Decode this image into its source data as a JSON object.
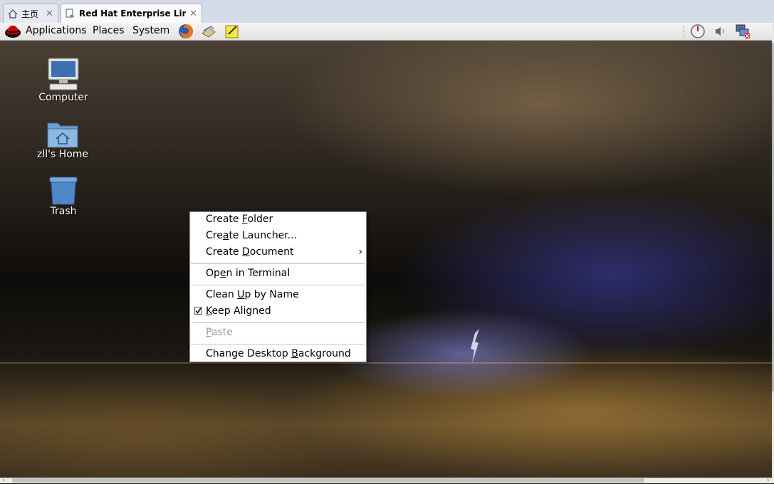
{
  "browser": {
    "tabs": [
      {
        "label": "主页",
        "icon": "home-icon"
      },
      {
        "label": "Red Hat Enterprise Linux ...",
        "icon": "vm-icon"
      }
    ]
  },
  "panel": {
    "menus": [
      "Applications",
      "Places",
      "System"
    ],
    "launchers": [
      "firefox-icon",
      "mail-icon",
      "notes-icon"
    ],
    "tray": [
      "clock-icon",
      "volume-icon",
      "network-icon"
    ]
  },
  "desktop": {
    "icons": [
      {
        "label": "Computer",
        "icon": "computer-icon"
      },
      {
        "label": "zll's Home",
        "icon": "home-folder-icon"
      },
      {
        "label": "Trash",
        "icon": "trash-icon"
      }
    ]
  },
  "context_menu": {
    "items": [
      {
        "label": "Create Folder",
        "mnemonic": "F"
      },
      {
        "label": "Create Launcher...",
        "mnemonic": "a"
      },
      {
        "label": "Create Document",
        "mnemonic": "D",
        "submenu": true
      },
      {
        "label": "Open in Terminal",
        "mnemonic": "e"
      },
      {
        "label": "Clean Up by Name",
        "mnemonic": "U"
      },
      {
        "label": "Keep Aligned",
        "mnemonic": "K",
        "checked": true
      },
      {
        "label": "Paste",
        "mnemonic": "P",
        "disabled": true
      },
      {
        "label": "Change Desktop Background",
        "mnemonic": "B"
      }
    ]
  },
  "colors": {
    "panel": "#e8e8e8",
    "menu_bg": "#ffffff",
    "disabled_text": "#9a9a9a"
  }
}
